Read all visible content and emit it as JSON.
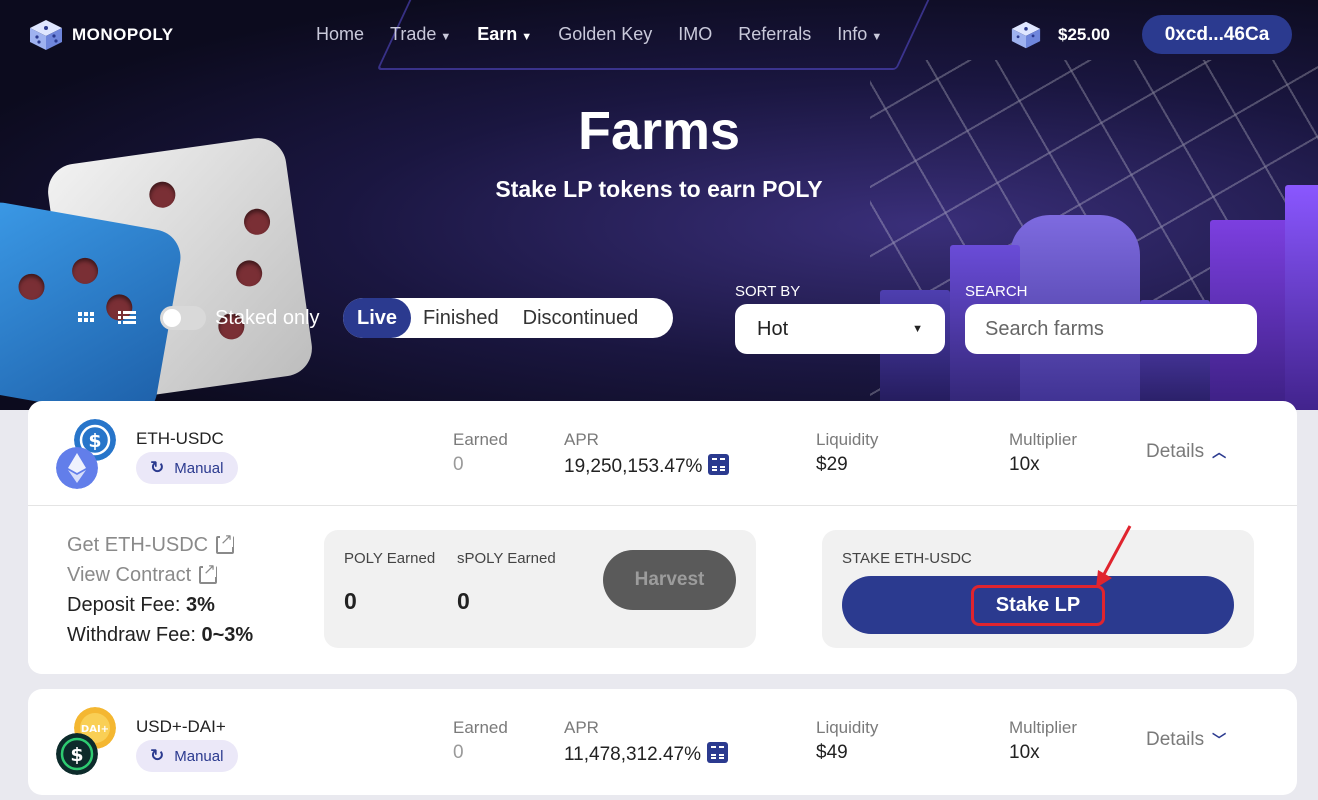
{
  "nav": {
    "logo_text": "MONOPOLY",
    "items": [
      {
        "label": "Home",
        "has_caret": false,
        "active": false
      },
      {
        "label": "Trade",
        "has_caret": true,
        "active": false
      },
      {
        "label": "Earn",
        "has_caret": true,
        "active": true
      },
      {
        "label": "Golden Key",
        "has_caret": false,
        "active": false
      },
      {
        "label": "IMO",
        "has_caret": false,
        "active": false
      },
      {
        "label": "Referrals",
        "has_caret": false,
        "active": false
      },
      {
        "label": "Info",
        "has_caret": true,
        "active": false
      }
    ],
    "price": "$25.00",
    "wallet": "0xcd...46Ca"
  },
  "hero": {
    "title": "Farms",
    "subtitle": "Stake LP tokens to earn POLY"
  },
  "filters": {
    "staked_only_label": "Staked only",
    "staked_only": false,
    "tabs": [
      "Live",
      "Finished",
      "Discontinued"
    ],
    "selected_tab": "Live",
    "sort_label": "SORT BY",
    "sort_value": "Hot",
    "search_label": "SEARCH",
    "search_placeholder": "Search farms"
  },
  "farms": [
    {
      "pair": "ETH-USDC",
      "mode": "Manual",
      "earned_label": "Earned",
      "earned": "0",
      "apr_label": "APR",
      "apr": "19,250,153.47%",
      "liquidity_label": "Liquidity",
      "liquidity": "$29",
      "multiplier_label": "Multiplier",
      "multiplier": "10x",
      "details_label": "Details",
      "expanded": true,
      "get_link": "Get ETH-USDC",
      "contract_link": "View Contract",
      "deposit_fee_label": "Deposit Fee:",
      "deposit_fee": "3%",
      "withdraw_fee_label": "Withdraw Fee:",
      "withdraw_fee": "0~3%",
      "poly_earned_label": "POLY Earned",
      "poly_earned": "0",
      "spoly_earned_label": "sPOLY Earned",
      "spoly_earned": "0",
      "harvest_label": "Harvest",
      "stake_title": "STAKE ETH-USDC",
      "stake_button": "Stake LP"
    },
    {
      "pair": "USD+-DAI+",
      "mode": "Manual",
      "earned_label": "Earned",
      "earned": "0",
      "apr_label": "APR",
      "apr": "11,478,312.47%",
      "liquidity_label": "Liquidity",
      "liquidity": "$49",
      "multiplier_label": "Multiplier",
      "multiplier": "10x",
      "details_label": "Details",
      "expanded": false,
      "token_badge": "DAI+"
    }
  ],
  "colors": {
    "primary": "#2b3a8f",
    "annotation": "#e0242e"
  }
}
